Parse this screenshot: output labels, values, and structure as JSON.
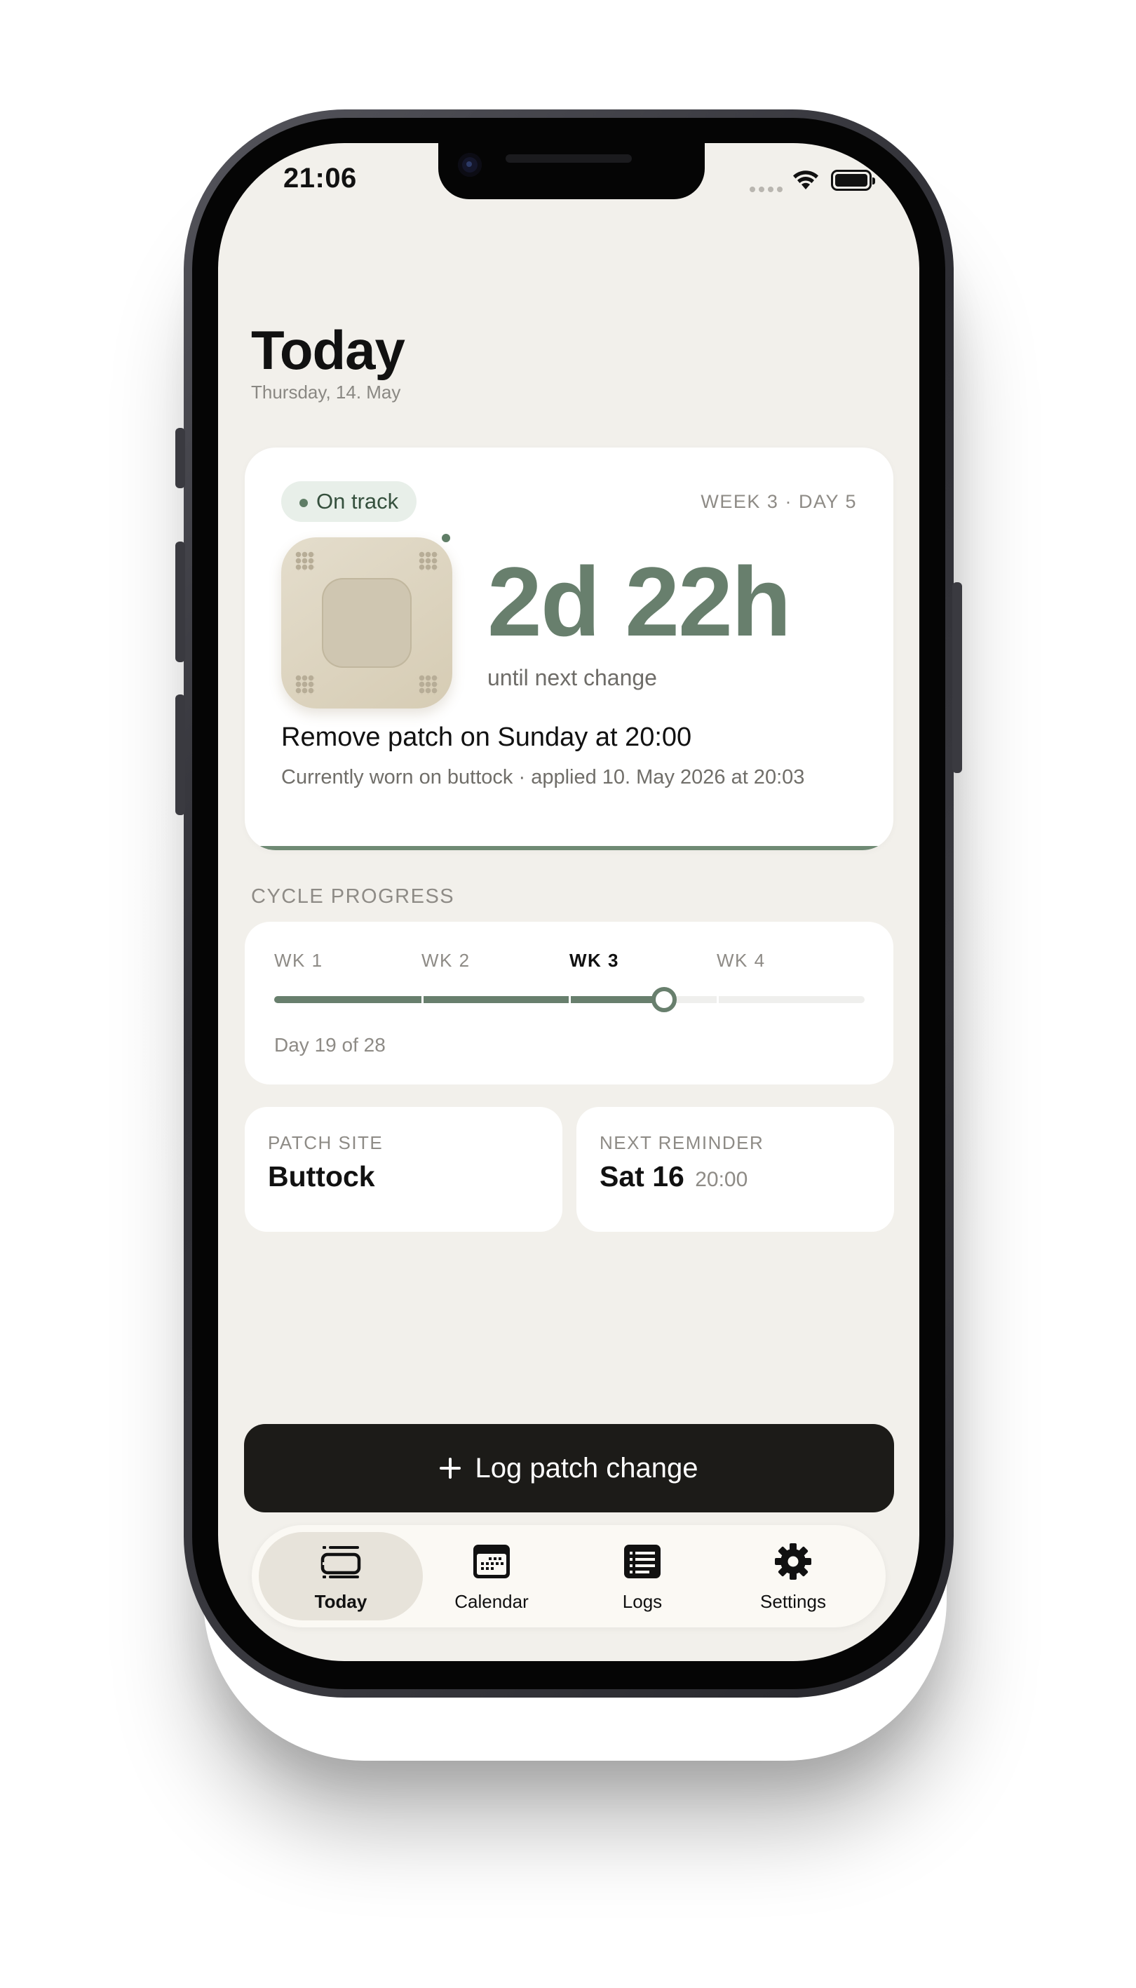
{
  "status_bar": {
    "time": "21:06"
  },
  "header": {
    "title": "Today",
    "date": "Thursday, 14. May"
  },
  "hero": {
    "badge": "On track",
    "week_day": "WEEK 3 · DAY 5",
    "countdown": "2d 22h",
    "countdown_label": "until next change",
    "remove_text": "Remove patch on Sunday at 20:00",
    "applied_text": "Currently worn on buttock · applied 10. May 2026 at 20:03"
  },
  "cycle": {
    "section_label": "CYCLE PROGRESS",
    "weeks": [
      "WK 1",
      "WK 2",
      "WK 3",
      "WK 4"
    ],
    "current_week_index": 2,
    "progress_fraction": 0.66,
    "day_text": "Day 19 of 28"
  },
  "info_cards": {
    "patch_site": {
      "label": "PATCH SITE",
      "value": "Buttock"
    },
    "next_reminder": {
      "label": "NEXT REMINDER",
      "value": "Sat 16",
      "time": "20:00"
    }
  },
  "log_button": {
    "label": "Log patch change",
    "icon": "plus-icon"
  },
  "tabs": [
    {
      "label": "Today",
      "icon": "today-icon",
      "active": true
    },
    {
      "label": "Calendar",
      "icon": "calendar-icon",
      "active": false
    },
    {
      "label": "Logs",
      "icon": "logs-icon",
      "active": false
    },
    {
      "label": "Settings",
      "icon": "gear-icon",
      "active": false
    }
  ],
  "colors": {
    "accent": "#687f6d",
    "background": "#f2f0eb",
    "card": "#ffffff",
    "button": "#1c1b18",
    "badge_bg": "#e8efe9"
  }
}
